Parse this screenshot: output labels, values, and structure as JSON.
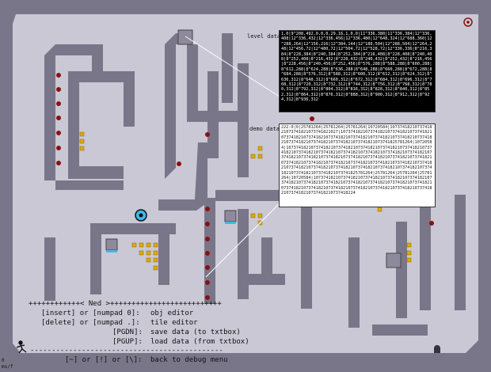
{
  "game": {
    "colors": {
      "wall": "#7a7689",
      "floor": "#c9c8d4",
      "panel_bg": "#ffffff",
      "level_panel_bg": "#000000",
      "mine": "#8b1010",
      "gold": "#e0a800",
      "player": "#3fb8e8",
      "door_panel": "#8e8a9c"
    },
    "icons": [
      "exit-door-icon",
      "player-icon",
      "mine-icon",
      "gold-icon",
      "runner-figure-icon",
      "target-icon"
    ],
    "level_label": "level data",
    "demo_label": "demo data",
    "level_data": "1,0|9^208,492,0,0,0,29,16,1,0,0|11^336,380|11^336,384|12^336,408|12^336,432|12^336,456|12^336,480|12^648,324|12^688,360|12^288,264|12^156,216|12^384,144|12^180,504|12^288,504|12^264,248|12^456,72|12^480,72|12^504,72|12^528,72|12^336,336|8^216,384|8^228,384|8^240,384|8^252,384|8^216,408|8^228,408|8^240,408|8^252,408|8^216,432|8^228,432|8^240,432|8^252,432|8^216,456|8^228,456|8^240,456|8^252,456|8^576,288|8^588,288|8^600,288|8^612,288|8^624,288|8^636,288|8^648,288|8^660,288|8^672,288|8^684,288|8^576,312|8^588,312|8^600,312|8^612,312|8^624,312|8^636,312|8^648,312|8^660,312|8^672,312|8^684,312|8^696,312|8^708,312|8^720,312|8^732,312|8^744,312|8^756,312|8^768,312|8^780,312|8^792,312|8^804,312|8^816,312|8^828,312|8^840,312|8^852,312|8^864,312|8^876,312|8^888,312|8^900,312|8^912,312|8^924,312|8^936,312",
    "demo_data": "222:0|0|25781264|25781264|25781264|10720584|1073741821073741821073741821073741821027|1073741821073741821073741821073741821073741821073741821073741821073741821073741821073741821073741821073741821073741821073741821073741821073741825781264|10720584|1073741821073741821073741821073741821073741821073741821073741821073741821073741821073741821073741821073741821073741821073741821073741821073741821073741821073741821073741821073741821073741821073741821073741821073741821073741821073741821073741821073741821073741821073741821073741821073741821073741821073741821073741821073741821073741825781264|25781264|25781264|25781264|10720584|10737418210737418210737418210737418210737418210737418210737418210737418210737418210737418210737418210737418210737418210737418210737418210737418210737418210737418210737418210737418210737418210737418224",
    "menu": {
      "title_line": "++++++++++++< Ned >++++++++++++++++++++++++++",
      "lines": [
        {
          "keys": "[insert] or [numpad 0]:",
          "action": "obj editor"
        },
        {
          "keys": "[delete] or [numpad .]:",
          "action": "tile editor"
        },
        {
          "keys": "[PGDN]:",
          "action": "save data (to txtbox)"
        },
        {
          "keys": "[PGUP]:",
          "action": "load data (from txtbox)"
        }
      ],
      "separator": "---------------------------------------------",
      "back_keys": "[~] or [!] or [\\]:",
      "back_action": "back to debug menu"
    },
    "hud": {
      "line1": "0",
      "line2": "ms/f"
    }
  }
}
